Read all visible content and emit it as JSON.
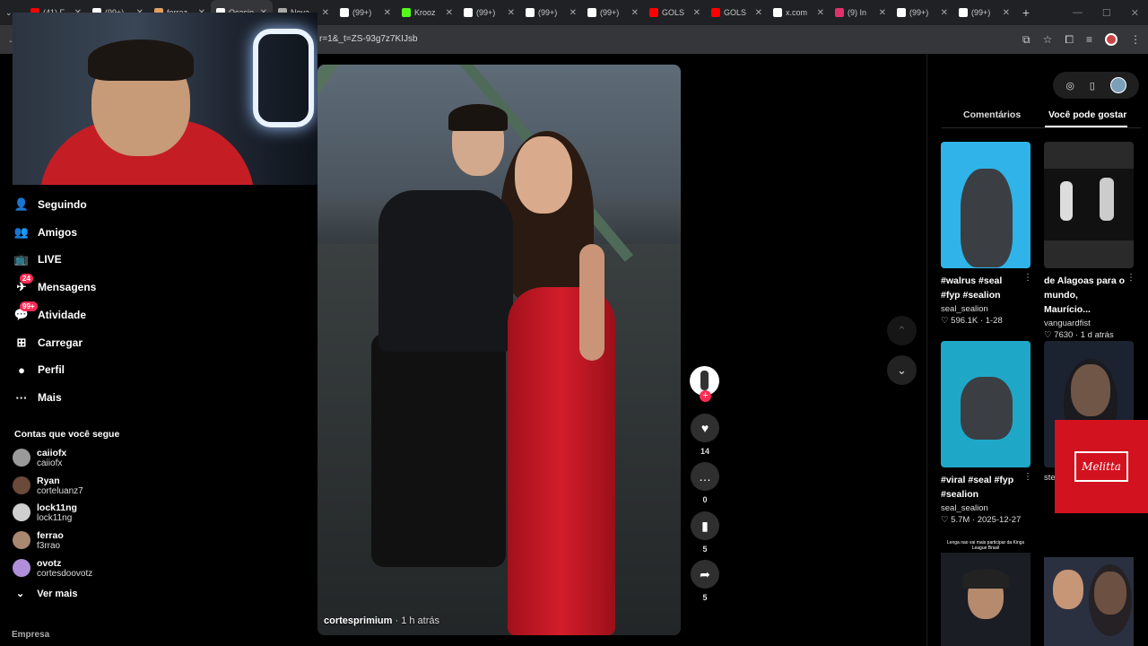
{
  "browser": {
    "tabs": [
      {
        "title": "(41) F",
        "icon": "youtube-icon",
        "color": "#ff0000"
      },
      {
        "title": "(99+)",
        "icon": "tiktok-icon",
        "color": "#ffffff"
      },
      {
        "title": "ferraz",
        "icon": "globe-icon",
        "color": "#e0a060"
      },
      {
        "title": "Ocasio",
        "icon": "tiktok-icon",
        "color": "#ffffff",
        "active": true
      },
      {
        "title": "Nova",
        "icon": "globe-icon",
        "color": "#aaaaaa"
      },
      {
        "title": "(99+)",
        "icon": "tiktok-icon",
        "color": "#ffffff"
      },
      {
        "title": "Krooz",
        "icon": "kick-icon",
        "color": "#53fc18"
      },
      {
        "title": "(99+)",
        "icon": "tiktok-icon",
        "color": "#ffffff"
      },
      {
        "title": "(99+)",
        "icon": "tiktok-icon",
        "color": "#ffffff"
      },
      {
        "title": "(99+)",
        "icon": "tiktok-icon",
        "color": "#ffffff"
      },
      {
        "title": "GOLS",
        "icon": "youtube-icon",
        "color": "#ff0000"
      },
      {
        "title": "GOLS",
        "icon": "youtube-icon",
        "color": "#ff0000"
      },
      {
        "title": "x.com",
        "icon": "x-icon",
        "color": "#ffffff"
      },
      {
        "title": "(9) In",
        "icon": "instagram-icon",
        "color": "#e1306c"
      },
      {
        "title": "(99+)",
        "icon": "tiktok-icon",
        "color": "#ffffff"
      },
      {
        "title": "(99+)",
        "icon": "tiktok-icon",
        "color": "#ffffff"
      }
    ],
    "url": "r=1&_t=ZS-93g7z7KIJsb"
  },
  "nav": {
    "items": [
      {
        "label": "Seguindo",
        "icon": "following-icon",
        "glyph": "👤"
      },
      {
        "label": "Amigos",
        "icon": "friends-icon",
        "glyph": "👥"
      },
      {
        "label": "LIVE",
        "icon": "live-icon",
        "glyph": "📺"
      },
      {
        "label": "Mensagens",
        "icon": "messages-icon",
        "glyph": "✈",
        "badge": "24"
      },
      {
        "label": "Atividade",
        "icon": "activity-icon",
        "glyph": "💬",
        "badge": "99+"
      },
      {
        "label": "Carregar",
        "icon": "upload-icon",
        "glyph": "⊞"
      },
      {
        "label": "Perfil",
        "icon": "profile-icon",
        "glyph": "●"
      },
      {
        "label": "Mais",
        "icon": "more-icon",
        "glyph": "···"
      }
    ],
    "following_title": "Contas que você segue",
    "accounts": [
      {
        "name": "caiiofx",
        "handle": "caiiofx",
        "color": "#9a9a9a"
      },
      {
        "name": "Ryan",
        "handle": "corteluanz7",
        "color": "#6b4a3a"
      },
      {
        "name": "lock11ng",
        "handle": "lock11ng",
        "color": "#cfcfcf"
      },
      {
        "name": "ferrao",
        "handle": "f3rrao",
        "color": "#a88870"
      },
      {
        "name": "ovotz",
        "handle": "cortesdoovotz",
        "color": "#b08fd8"
      }
    ],
    "see_more": "Ver mais",
    "footer": "Empresa"
  },
  "video": {
    "author": "cortesprimium",
    "time": "· 1 h atrás"
  },
  "actions": {
    "likes": "14",
    "comments": "0",
    "saves": "5",
    "shares": "5"
  },
  "right": {
    "tab_comments": "Comentários",
    "tab_suggested": "Você pode gostar",
    "cards": [
      {
        "caption": "#walrus #seal #fyp #sealion",
        "author": "seal_sealion",
        "likes": "596.1K",
        "date": "1-28",
        "bg": "#2fb3e8"
      },
      {
        "caption": "de Alagoas para o mundo, Maurício...",
        "author": "vanguardfist",
        "likes": "7630",
        "date": "1 d atrás",
        "bg": "#2a2a2a"
      },
      {
        "caption": "#viral #seal #fyp #sealion",
        "author": "seal_sealion",
        "likes": "5.7M",
        "date": "2025-12-27",
        "bg": "#1fa7c8"
      },
      {
        "caption": "",
        "author": "ste",
        "likes": "",
        "date": "",
        "bg": "#1b2230"
      }
    ],
    "bottom_thumb_text": "Lenga nao vai mais participar da Kings League Brasil",
    "ad_brand": "Melitta",
    "brand_red": "#d2121e"
  }
}
